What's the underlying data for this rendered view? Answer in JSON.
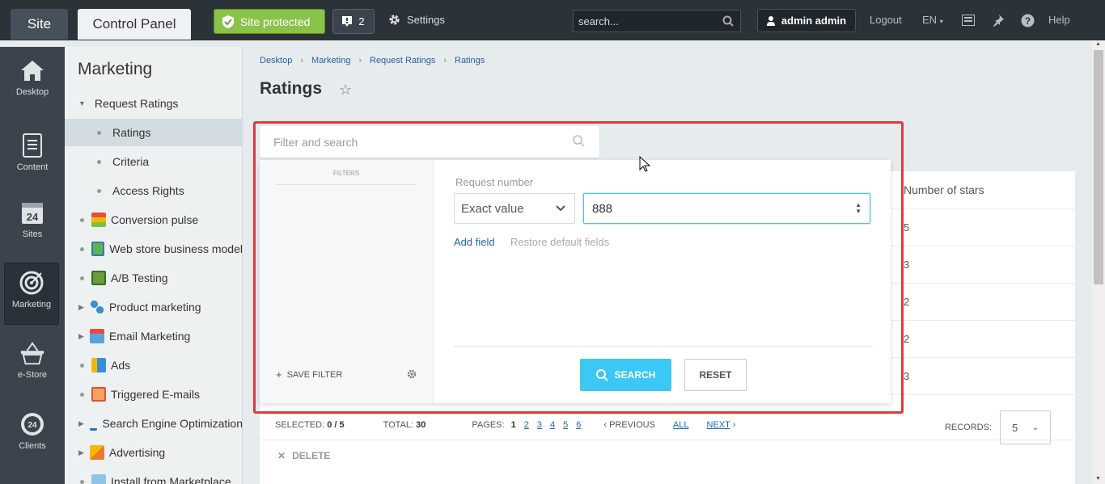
{
  "topbar": {
    "site": "Site",
    "control_panel": "Control Panel",
    "protected": "Site protected",
    "notif_count": "2",
    "settings": "Settings",
    "search_placeholder": "search...",
    "user": "admin admin",
    "logout": "Logout",
    "lang": "EN",
    "help": "Help"
  },
  "left_sidebar": [
    {
      "label": "Desktop",
      "icon": "home-icon"
    },
    {
      "label": "Content",
      "icon": "document-icon"
    },
    {
      "label": "Sites",
      "icon": "calendar-24-icon"
    },
    {
      "label": "Marketing",
      "icon": "target-icon"
    },
    {
      "label": "e-Store",
      "icon": "basket-icon"
    },
    {
      "label": "Clients",
      "icon": "clients-24-icon"
    }
  ],
  "menu": {
    "title": "Marketing",
    "items": [
      {
        "label": "Request Ratings"
      },
      {
        "label": "Ratings"
      },
      {
        "label": "Criteria"
      },
      {
        "label": "Access Rights"
      },
      {
        "label": "Conversion pulse"
      },
      {
        "label": "Web store business model"
      },
      {
        "label": "A/B Testing"
      },
      {
        "label": "Product marketing"
      },
      {
        "label": "Email Marketing"
      },
      {
        "label": "Ads"
      },
      {
        "label": "Triggered E-mails"
      },
      {
        "label": "Search Engine Optimization"
      },
      {
        "label": "Advertising"
      },
      {
        "label": "Install from Marketplace"
      }
    ]
  },
  "breadcrumb": [
    "Desktop",
    "Marketing",
    "Request Ratings",
    "Ratings"
  ],
  "page_title": "Ratings",
  "filter": {
    "search_placeholder": "Filter and search",
    "filters_header": "FILTERS",
    "save_filter": "SAVE FILTER",
    "field_label": "Request number",
    "match_type": "Exact value",
    "value": "888",
    "add_field": "Add field",
    "restore": "Restore default fields",
    "search_btn": "SEARCH",
    "reset_btn": "RESET"
  },
  "grid": {
    "col_stars": "Number of stars",
    "stars": [
      "5",
      "3",
      "2",
      "2",
      "3"
    ]
  },
  "pager": {
    "selected_label": "SELECTED:",
    "selected": "0 / 5",
    "total_label": "TOTAL:",
    "total": "30",
    "pages_label": "PAGES:",
    "pages": [
      "1",
      "2",
      "3",
      "4",
      "5",
      "6"
    ],
    "previous": "PREVIOUS",
    "all": "ALL",
    "next": "NEXT",
    "records_label": "RECORDS:",
    "records": "5"
  },
  "delete": "DELETE"
}
